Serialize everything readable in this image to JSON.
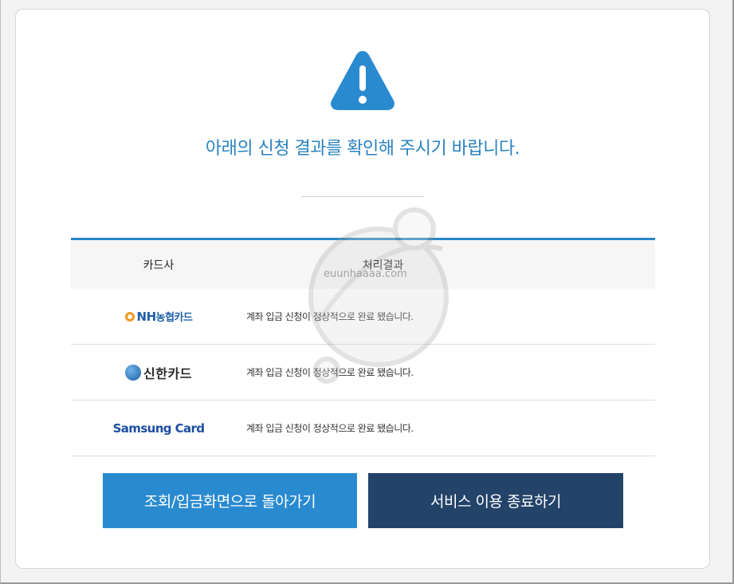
{
  "alert": {
    "icon": "warning-triangle-icon",
    "color": "#2a8ad0"
  },
  "headline": "아래의 신청 결과를 확인해 주시기 바랍니다.",
  "table": {
    "headers": {
      "company": "카드사",
      "result": "처리결과"
    },
    "rows": [
      {
        "company": "NH농협카드",
        "logo_mark": "NH",
        "logo_sub": "농협카드",
        "result": "계좌 입금 신청이 정상적으로 완료 됐습니다."
      },
      {
        "company": "신한카드",
        "result": "계좌 입금 신청이 정상적으로 완료 됐습니다."
      },
      {
        "company": "Samsung Card",
        "result": "계좌 입금 신청이 정상적으로 완료 됐습니다."
      }
    ]
  },
  "buttons": {
    "back_label": "조회/입금화면으로 돌아가기",
    "end_label": "서비스 이용 종료하기"
  },
  "watermark": {
    "text": "euunhaaaa.com"
  },
  "colors": {
    "accent": "#2a8ad0",
    "dark": "#234369",
    "headline": "#2a83c0"
  }
}
